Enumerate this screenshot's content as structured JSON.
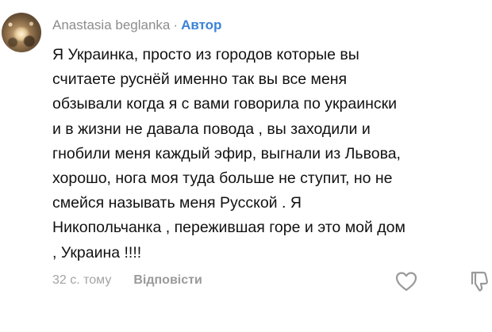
{
  "comment": {
    "author_name": "Anastasia beglanka",
    "separator": "·",
    "author_badge": "Автор",
    "lines": [
      "Я Украинка, просто из городов которые вы",
      "считаете руснёй именно так вы все меня",
      "обзывали когда я с вами говорила по украински",
      "и в жизни не давала повода , вы заходили и",
      "гнобили меня каждый эфир, выгнали из Львова,",
      "хорошо, нога моя туда больше не ступит, но не",
      "смейся называть меня Русской . Я",
      "Никопольчанка , пережившая горе и это мой дом",
      ", Украина !!!!"
    ],
    "timestamp": "32 с. тому",
    "reply_label": "Відповісти",
    "icons": {
      "like": "heart-outline-icon",
      "dislike": "thumbs-down-outline-icon"
    },
    "colors": {
      "badge": "#3b82d8",
      "meta": "#8d8d8d"
    }
  }
}
